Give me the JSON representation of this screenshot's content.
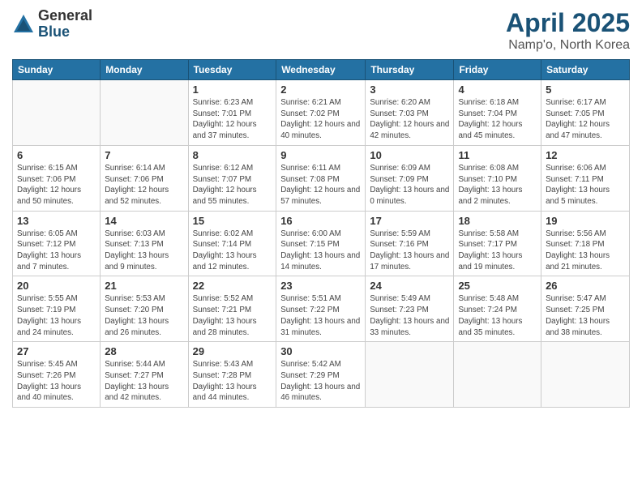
{
  "logo": {
    "general": "General",
    "blue": "Blue"
  },
  "title": "April 2025",
  "location": "Namp'o, North Korea",
  "weekdays": [
    "Sunday",
    "Monday",
    "Tuesday",
    "Wednesday",
    "Thursday",
    "Friday",
    "Saturday"
  ],
  "days": [
    {
      "num": "",
      "info": ""
    },
    {
      "num": "",
      "info": ""
    },
    {
      "num": "1",
      "info": "Sunrise: 6:23 AM\nSunset: 7:01 PM\nDaylight: 12 hours and 37 minutes."
    },
    {
      "num": "2",
      "info": "Sunrise: 6:21 AM\nSunset: 7:02 PM\nDaylight: 12 hours and 40 minutes."
    },
    {
      "num": "3",
      "info": "Sunrise: 6:20 AM\nSunset: 7:03 PM\nDaylight: 12 hours and 42 minutes."
    },
    {
      "num": "4",
      "info": "Sunrise: 6:18 AM\nSunset: 7:04 PM\nDaylight: 12 hours and 45 minutes."
    },
    {
      "num": "5",
      "info": "Sunrise: 6:17 AM\nSunset: 7:05 PM\nDaylight: 12 hours and 47 minutes."
    },
    {
      "num": "6",
      "info": "Sunrise: 6:15 AM\nSunset: 7:06 PM\nDaylight: 12 hours and 50 minutes."
    },
    {
      "num": "7",
      "info": "Sunrise: 6:14 AM\nSunset: 7:06 PM\nDaylight: 12 hours and 52 minutes."
    },
    {
      "num": "8",
      "info": "Sunrise: 6:12 AM\nSunset: 7:07 PM\nDaylight: 12 hours and 55 minutes."
    },
    {
      "num": "9",
      "info": "Sunrise: 6:11 AM\nSunset: 7:08 PM\nDaylight: 12 hours and 57 minutes."
    },
    {
      "num": "10",
      "info": "Sunrise: 6:09 AM\nSunset: 7:09 PM\nDaylight: 13 hours and 0 minutes."
    },
    {
      "num": "11",
      "info": "Sunrise: 6:08 AM\nSunset: 7:10 PM\nDaylight: 13 hours and 2 minutes."
    },
    {
      "num": "12",
      "info": "Sunrise: 6:06 AM\nSunset: 7:11 PM\nDaylight: 13 hours and 5 minutes."
    },
    {
      "num": "13",
      "info": "Sunrise: 6:05 AM\nSunset: 7:12 PM\nDaylight: 13 hours and 7 minutes."
    },
    {
      "num": "14",
      "info": "Sunrise: 6:03 AM\nSunset: 7:13 PM\nDaylight: 13 hours and 9 minutes."
    },
    {
      "num": "15",
      "info": "Sunrise: 6:02 AM\nSunset: 7:14 PM\nDaylight: 13 hours and 12 minutes."
    },
    {
      "num": "16",
      "info": "Sunrise: 6:00 AM\nSunset: 7:15 PM\nDaylight: 13 hours and 14 minutes."
    },
    {
      "num": "17",
      "info": "Sunrise: 5:59 AM\nSunset: 7:16 PM\nDaylight: 13 hours and 17 minutes."
    },
    {
      "num": "18",
      "info": "Sunrise: 5:58 AM\nSunset: 7:17 PM\nDaylight: 13 hours and 19 minutes."
    },
    {
      "num": "19",
      "info": "Sunrise: 5:56 AM\nSunset: 7:18 PM\nDaylight: 13 hours and 21 minutes."
    },
    {
      "num": "20",
      "info": "Sunrise: 5:55 AM\nSunset: 7:19 PM\nDaylight: 13 hours and 24 minutes."
    },
    {
      "num": "21",
      "info": "Sunrise: 5:53 AM\nSunset: 7:20 PM\nDaylight: 13 hours and 26 minutes."
    },
    {
      "num": "22",
      "info": "Sunrise: 5:52 AM\nSunset: 7:21 PM\nDaylight: 13 hours and 28 minutes."
    },
    {
      "num": "23",
      "info": "Sunrise: 5:51 AM\nSunset: 7:22 PM\nDaylight: 13 hours and 31 minutes."
    },
    {
      "num": "24",
      "info": "Sunrise: 5:49 AM\nSunset: 7:23 PM\nDaylight: 13 hours and 33 minutes."
    },
    {
      "num": "25",
      "info": "Sunrise: 5:48 AM\nSunset: 7:24 PM\nDaylight: 13 hours and 35 minutes."
    },
    {
      "num": "26",
      "info": "Sunrise: 5:47 AM\nSunset: 7:25 PM\nDaylight: 13 hours and 38 minutes."
    },
    {
      "num": "27",
      "info": "Sunrise: 5:45 AM\nSunset: 7:26 PM\nDaylight: 13 hours and 40 minutes."
    },
    {
      "num": "28",
      "info": "Sunrise: 5:44 AM\nSunset: 7:27 PM\nDaylight: 13 hours and 42 minutes."
    },
    {
      "num": "29",
      "info": "Sunrise: 5:43 AM\nSunset: 7:28 PM\nDaylight: 13 hours and 44 minutes."
    },
    {
      "num": "30",
      "info": "Sunrise: 5:42 AM\nSunset: 7:29 PM\nDaylight: 13 hours and 46 minutes."
    },
    {
      "num": "",
      "info": ""
    },
    {
      "num": "",
      "info": ""
    },
    {
      "num": "",
      "info": ""
    }
  ]
}
